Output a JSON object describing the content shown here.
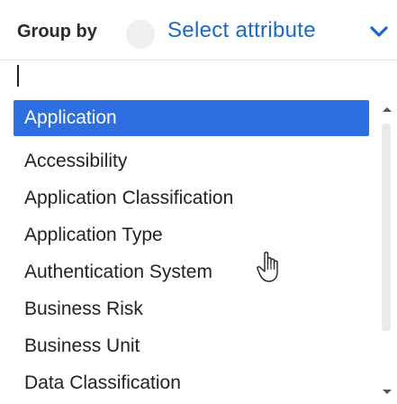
{
  "header": {
    "group_by_label": "Group by",
    "select_attribute_label": "Select attribute"
  },
  "search": {
    "value": "",
    "placeholder": ""
  },
  "options": [
    {
      "label": "Application",
      "selected": true
    },
    {
      "label": "Accessibility",
      "selected": false
    },
    {
      "label": "Application Classification",
      "selected": false
    },
    {
      "label": "Application Type",
      "selected": false
    },
    {
      "label": "Authentication System",
      "selected": false
    },
    {
      "label": "Business Risk",
      "selected": false
    },
    {
      "label": "Business Unit",
      "selected": false
    },
    {
      "label": "Data Classification",
      "selected": false
    }
  ],
  "colors": {
    "accent": "#1a69c4",
    "selected_bg": "#2d6ee0",
    "text": "#222222"
  },
  "icons": {
    "dropdown": "chevron-down-icon",
    "scroll_up": "chevron-up-icon",
    "scroll_down": "chevron-down-icon",
    "cursor": "hand-pointer-icon"
  }
}
